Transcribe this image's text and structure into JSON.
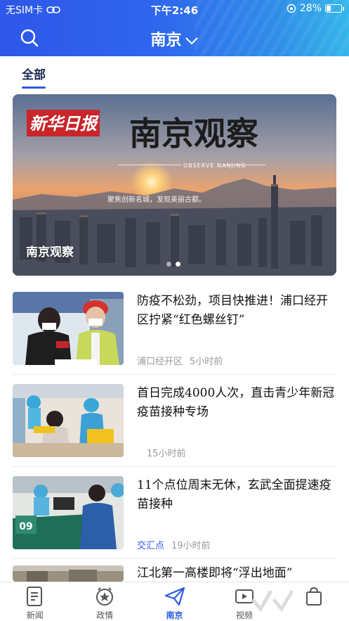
{
  "status_bar": {
    "carrier": "无SIM卡",
    "time": "下午2:46",
    "battery": "28%",
    "battery_level": 0.28
  },
  "header": {
    "city": "南京",
    "search_icon": "search-icon",
    "dropdown_icon": "chevron-down-icon"
  },
  "tabs": [
    {
      "label": "全部",
      "active": true
    }
  ],
  "banner": {
    "logo_text": "新华日报",
    "headline": "南京观察",
    "headline_en": "OBSERVE NANJING",
    "slogan": "聚焦创新名城，发现美丽古都。",
    "caption": "南京观察",
    "slide_count": 2,
    "active_slide": 2
  },
  "news": [
    {
      "title": "防疫不松劲，项目快推进！浦口经开区拧紧“红色螺丝钉”",
      "source": "浦口经开区",
      "source_is_tag": false,
      "time": "5小时前"
    },
    {
      "title": "首日完成4000人次，直击青少年新冠疫苗接种专场",
      "source": "",
      "source_is_tag": false,
      "time": "15小时前"
    },
    {
      "title": "11个点位周末无休，玄武全面提速疫苗接种",
      "source": "交汇点",
      "source_is_tag": true,
      "time": "19小时前"
    },
    {
      "title": "江北第一高楼即将“浮出地面”",
      "source": "",
      "source_is_tag": false,
      "time": ""
    }
  ],
  "bottom_nav": [
    {
      "label": "新闻",
      "icon": "newspaper-icon",
      "active": false
    },
    {
      "label": "政情",
      "icon": "emblem-icon",
      "active": false
    },
    {
      "label": "南京",
      "icon": "paper-plane-icon",
      "active": true
    },
    {
      "label": "视频",
      "icon": "video-icon",
      "active": false
    },
    {
      "label": "",
      "icon": "bag-icon",
      "active": false
    }
  ],
  "colors": {
    "accent": "#2d5be3",
    "header_start": "#2f57e8",
    "header_end": "#35b6ea",
    "meta_gray": "#9a9a9a"
  }
}
